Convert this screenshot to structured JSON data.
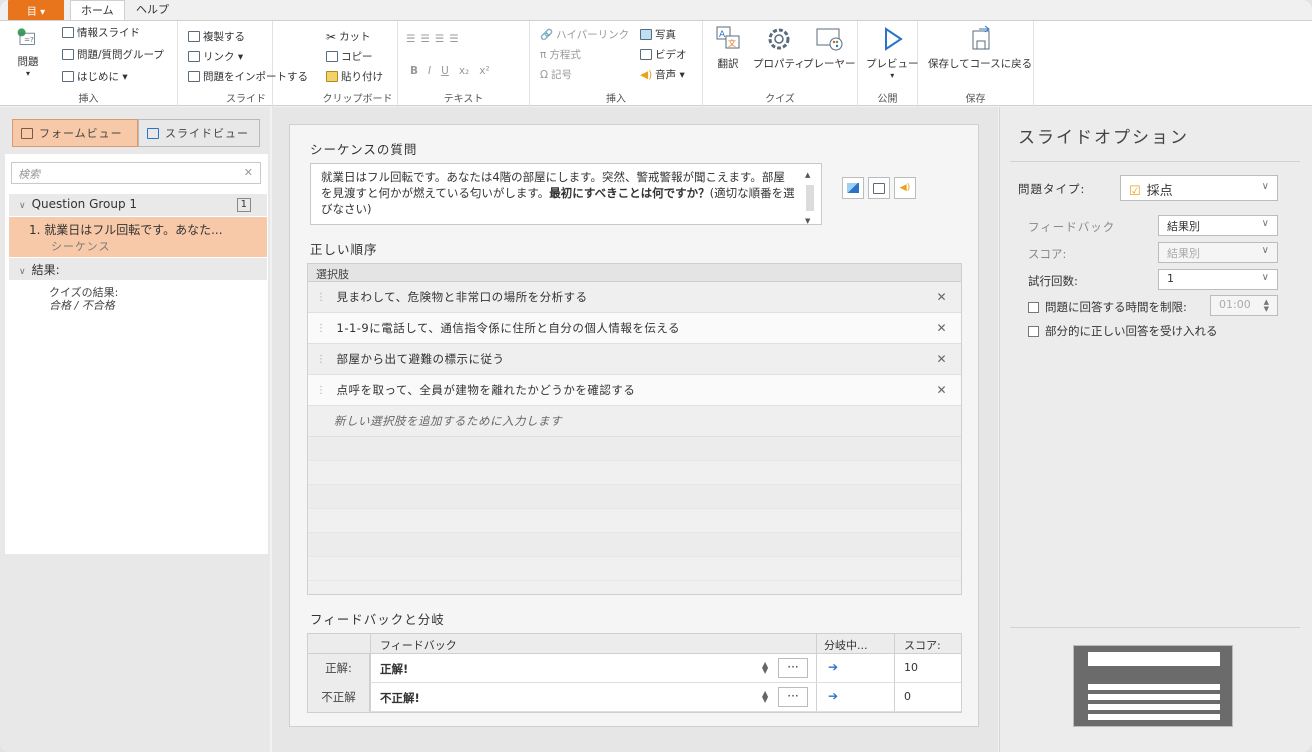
{
  "tabs": {
    "app_menu": "目 ▾",
    "home": "ホーム",
    "help": "ヘルプ"
  },
  "ribbon": {
    "insert": {
      "question": "問題",
      "info_slide": "情報スライド",
      "question_group": "問題/質問グループ",
      "intro": "はじめに ▾",
      "label": "挿入"
    },
    "slide": {
      "duplicate": "複製する",
      "link": "リンク ▾",
      "import": "問題をインポートする",
      "label": "スライド"
    },
    "clipboard": {
      "cut": "カット",
      "copy": "コピー",
      "paste": "貼り付け",
      "label": "クリップボード"
    },
    "text": {
      "bold": "B",
      "italic": "I",
      "underline": "U",
      "sub": "x₂",
      "sup": "x²",
      "label": "テキスト"
    },
    "insert2": {
      "hyperlink": "ハイパーリンク",
      "formula": "方程式",
      "symbol": "記号",
      "photo": "写真",
      "video": "ビデオ",
      "audio": "音声 ▾",
      "label": "挿入"
    },
    "quiz": {
      "translate": "翻訳",
      "properties": "プロパティ",
      "player": "プレーヤー",
      "label": "クイズ"
    },
    "publish": {
      "preview": "プレビュー",
      "label": "公開"
    },
    "save": {
      "save_return": "保存してコースに戻る",
      "label": "保存"
    }
  },
  "left": {
    "form_view": "フォームビュー",
    "slide_view": "スライドビュー",
    "search_placeholder": "検索",
    "group_name": "Question Group 1",
    "group_count": "1",
    "item_title": "1. 就業日はフル回転です。あなた...",
    "item_sub": "シーケンス",
    "results": "結果:",
    "result_title": "クイズの結果:",
    "result_sub": "合格 / 不合格"
  },
  "center": {
    "question_heading": "シーケンスの質問",
    "question_text": "就業日はフル回転です。あなたは4階の部屋にします。突然、警戒警報が聞こえます。部屋を見渡すと何かが燃えている匂いがします。",
    "question_bold": "最初にすべきことは何ですか？",
    "question_tail": "(適切な順番を選びなさい)",
    "correct_order": "正しい順序",
    "choices_header": "選択肢",
    "choices": [
      "見まわして、危険物と非常口の場所を分析する",
      "1-1-9に電話して、通信指令係に住所と自分の個人情報を伝える",
      "部屋から出て避難の標示に従う",
      "点呼を取って、全員が建物を離れたかどうかを確認する"
    ],
    "new_choice": "新しい選択肢を追加するために入力します",
    "feedback_heading": "フィードバックと分岐",
    "fb_col_feedback": "フィードバック",
    "fb_col_branch": "分岐中...",
    "fb_col_score": "スコア:",
    "fb_rows": [
      {
        "label": "正解:",
        "text": "正解!",
        "score": "10"
      },
      {
        "label": "不正解",
        "text": "不正解!",
        "score": "0"
      }
    ]
  },
  "right": {
    "title": "スライドオプション",
    "question_type_label": "問題タイプ:",
    "question_type_value": "採点",
    "feedback_label": "フィードバック",
    "feedback_value": "結果別",
    "score_label": "スコア:",
    "score_value": "結果別",
    "attempts_label": "試行回数:",
    "attempts_value": "1",
    "time_limit_label": "問題に回答する時間を制限:",
    "time_limit_value": "01:00",
    "partial_label": "部分的に正しい回答を受け入れる"
  }
}
